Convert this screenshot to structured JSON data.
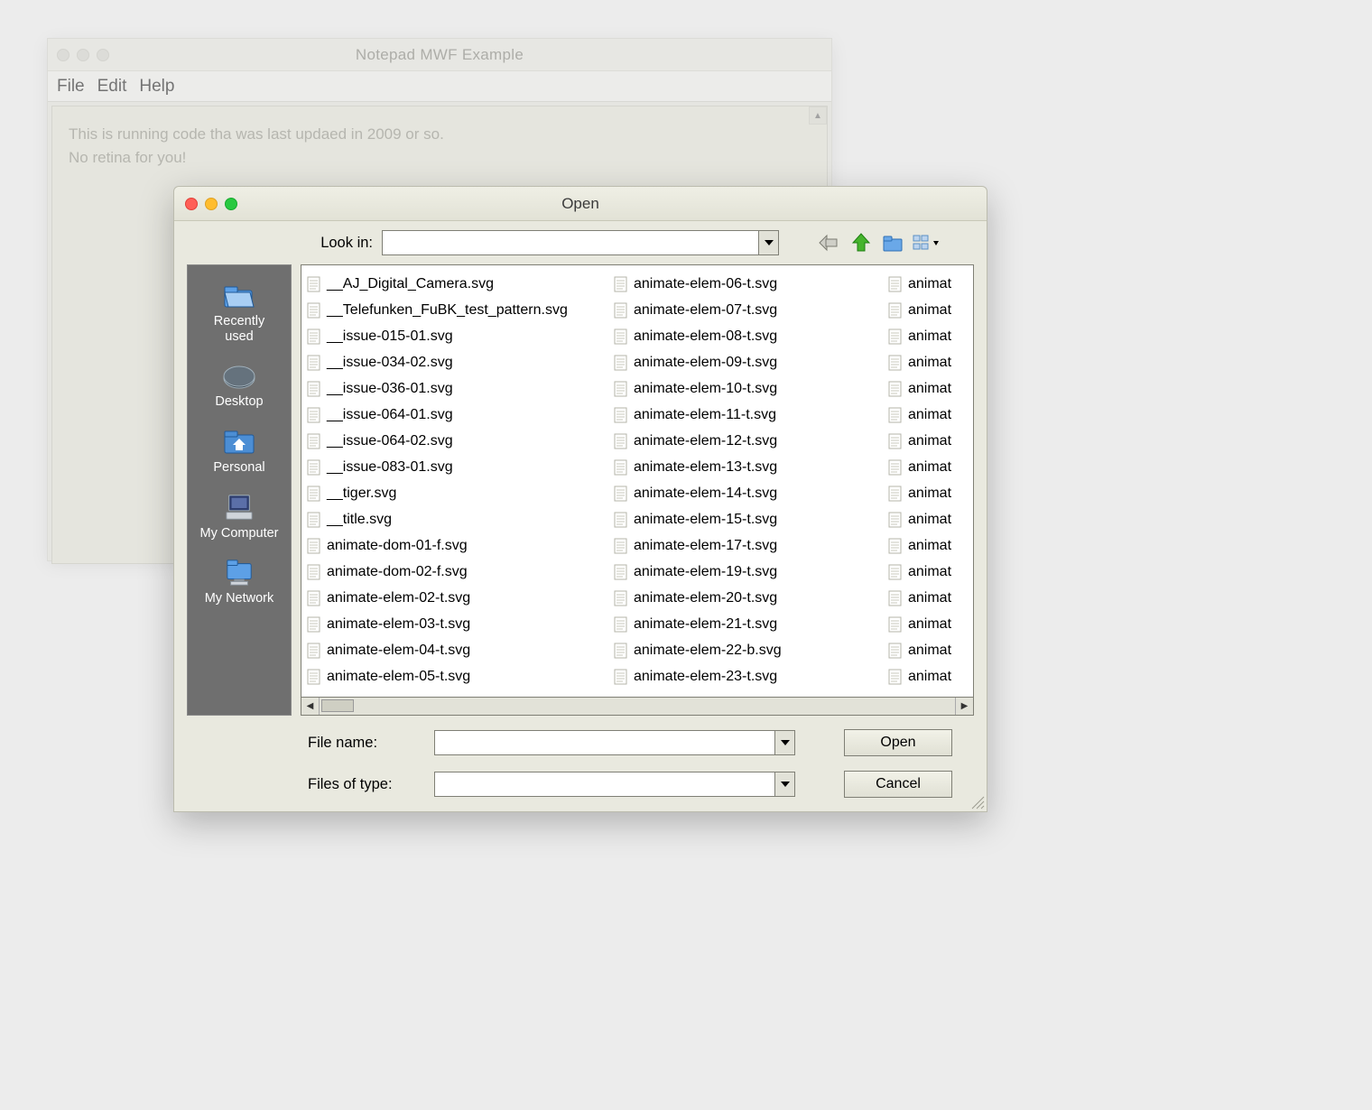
{
  "back_window": {
    "title": "Notepad MWF Example",
    "menus": [
      "File",
      "Edit",
      "Help"
    ],
    "editor_lines": [
      "This is running code tha   was last updaed in 2009 or so.",
      "",
      "No retina for you!"
    ]
  },
  "dialog": {
    "title": "Open",
    "look_in_label": "Look in:",
    "look_in_value": "",
    "places": [
      {
        "label": "Recently\nused",
        "icon": "folder-recent"
      },
      {
        "label": "Desktop",
        "icon": "desktop"
      },
      {
        "label": "Personal",
        "icon": "folder-home"
      },
      {
        "label": "My Computer",
        "icon": "computer"
      },
      {
        "label": "My Network",
        "icon": "folder-network"
      }
    ],
    "toolbar_icons": [
      "back",
      "up",
      "new-folder",
      "view-menu"
    ],
    "files": {
      "col1": [
        "__AJ_Digital_Camera.svg",
        "__Telefunken_FuBK_test_pattern.svg",
        "__issue-015-01.svg",
        "__issue-034-02.svg",
        "__issue-036-01.svg",
        "__issue-064-01.svg",
        "__issue-064-02.svg",
        "__issue-083-01.svg",
        "__tiger.svg",
        "__title.svg",
        "animate-dom-01-f.svg",
        "animate-dom-02-f.svg",
        "animate-elem-02-t.svg",
        "animate-elem-03-t.svg",
        "animate-elem-04-t.svg",
        "animate-elem-05-t.svg"
      ],
      "col2": [
        "animate-elem-06-t.svg",
        "animate-elem-07-t.svg",
        "animate-elem-08-t.svg",
        "animate-elem-09-t.svg",
        "animate-elem-10-t.svg",
        "animate-elem-11-t.svg",
        "animate-elem-12-t.svg",
        "animate-elem-13-t.svg",
        "animate-elem-14-t.svg",
        "animate-elem-15-t.svg",
        "animate-elem-17-t.svg",
        "animate-elem-19-t.svg",
        "animate-elem-20-t.svg",
        "animate-elem-21-t.svg",
        "animate-elem-22-b.svg",
        "animate-elem-23-t.svg"
      ],
      "col3": [
        "animat",
        "animat",
        "animat",
        "animat",
        "animat",
        "animat",
        "animat",
        "animat",
        "animat",
        "animat",
        "animat",
        "animat",
        "animat",
        "animat",
        "animat",
        "animat"
      ]
    },
    "file_name_label": "File name:",
    "file_name_value": "",
    "file_type_label": "Files of type:",
    "file_type_value": "",
    "open_button": "Open",
    "cancel_button": "Cancel"
  }
}
